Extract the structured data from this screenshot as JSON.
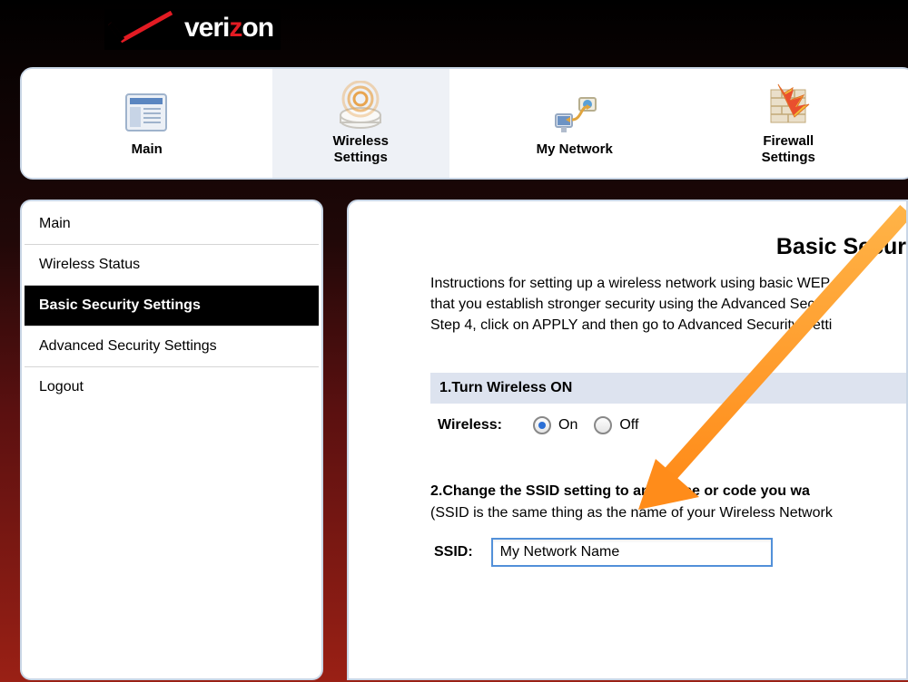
{
  "brand": {
    "name": "verizon"
  },
  "nav": {
    "items": [
      {
        "label": "Main",
        "active": false
      },
      {
        "label": "Wireless\nSettings",
        "active": true
      },
      {
        "label": "My Network",
        "active": false
      },
      {
        "label": "Firewall\nSettings",
        "active": false
      }
    ]
  },
  "sidebar": {
    "items": [
      {
        "label": "Main",
        "active": false
      },
      {
        "label": "Wireless Status",
        "active": false
      },
      {
        "label": "Basic Security Settings",
        "active": true
      },
      {
        "label": "Advanced Security Settings",
        "active": false
      },
      {
        "label": "Logout",
        "active": false
      }
    ]
  },
  "panel": {
    "title": "Basic Secur",
    "instructions_line1": "Instructions for setting up a wireless network using basic WEP",
    "instructions_line2": "that you establish stronger security using the Advanced Secur",
    "instructions_line3": "Step 4, click on APPLY and then go to Advanced Security Setti",
    "section1_title": "1.Turn Wireless ON",
    "wireless_label": "Wireless:",
    "radio_on": "On",
    "radio_off": "Off",
    "wireless_value": "On",
    "section2_title": "2.Change the SSID setting to any name or code you wa",
    "ssid_description": "(SSID is the same thing as the name of your Wireless Network",
    "ssid_label": "SSID:",
    "ssid_value": "My Network Name"
  }
}
